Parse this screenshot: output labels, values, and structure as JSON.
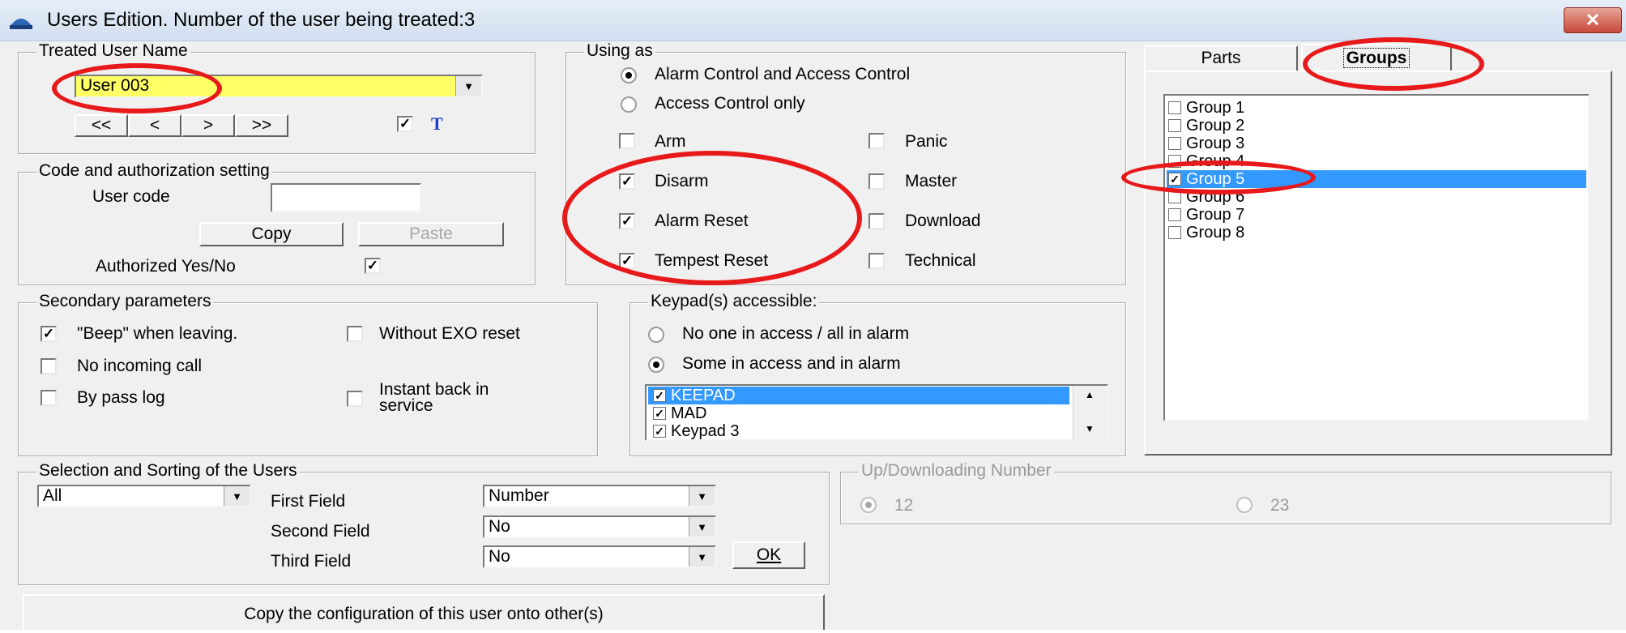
{
  "window": {
    "title": "Users Edition.  Number of the user being treated:3",
    "close_glyph": "✕"
  },
  "treated_user": {
    "group_label": "Treated User Name",
    "selected_user": "User 003",
    "nav": [
      "<<",
      "<",
      ">",
      ">>"
    ],
    "t_checked": true,
    "t_label": "T"
  },
  "code_auth": {
    "group_label": "Code and authorization setting",
    "user_code_label": "User code",
    "user_code_value": "",
    "copy_label": "Copy",
    "paste_label": "Paste",
    "authorized_label": "Authorized Yes/No",
    "authorized_checked": true
  },
  "using_as": {
    "group_label": "Using as",
    "radios": [
      {
        "label": "Alarm Control and Access Control",
        "selected": true
      },
      {
        "label": "Access Control only",
        "selected": false
      }
    ],
    "checkboxes_left": [
      {
        "label": "Arm",
        "checked": false
      },
      {
        "label": "Disarm",
        "checked": true
      },
      {
        "label": "Alarm Reset",
        "checked": true
      },
      {
        "label": "Tempest Reset",
        "checked": true
      }
    ],
    "checkboxes_right": [
      {
        "label": "Panic",
        "checked": false
      },
      {
        "label": "Master",
        "checked": false
      },
      {
        "label": "Download",
        "checked": false
      },
      {
        "label": "Technical",
        "checked": false
      }
    ]
  },
  "tabs": [
    {
      "label": "Parts",
      "active": false
    },
    {
      "label": "Groups",
      "active": true
    }
  ],
  "groups": [
    {
      "label": "Group 1",
      "checked": false,
      "selected": false
    },
    {
      "label": "Group 2",
      "checked": false,
      "selected": false
    },
    {
      "label": "Group 3",
      "checked": false,
      "selected": false
    },
    {
      "label": "Group 4",
      "checked": false,
      "selected": false
    },
    {
      "label": "Group 5",
      "checked": true,
      "selected": true
    },
    {
      "label": "Group 6",
      "checked": false,
      "selected": false
    },
    {
      "label": "Group 7",
      "checked": false,
      "selected": false
    },
    {
      "label": "Group 8",
      "checked": false,
      "selected": false
    }
  ],
  "secondary": {
    "group_label": "Secondary parameters",
    "beep": {
      "label": "\"Beep\" when leaving.",
      "checked": true
    },
    "without_exo": {
      "label": "Without EXO reset",
      "checked": false
    },
    "no_incoming": {
      "label": "No incoming call",
      "checked": false
    },
    "bypass": {
      "label": "By pass log",
      "checked": false
    },
    "instant_back": {
      "line1": "Instant back in",
      "line2": "service",
      "checked": false
    }
  },
  "keypads": {
    "group_label": "Keypad(s) accessible:",
    "radios": [
      {
        "label": "No one in access / all in alarm",
        "selected": false
      },
      {
        "label": "Some in access and in alarm",
        "selected": true
      }
    ],
    "items": [
      {
        "label": "KEEPAD",
        "checked": true,
        "selected": true
      },
      {
        "label": "MAD",
        "checked": true,
        "selected": false
      },
      {
        "label": "Keypad 3",
        "checked": true,
        "selected": false
      }
    ]
  },
  "selection": {
    "group_label": "Selection and Sorting of the Users",
    "filter_value": "All",
    "first_label": "First Field",
    "first_value": "Number",
    "second_label": "Second Field",
    "second_value": "No",
    "third_label": "Third Field",
    "third_value": "No",
    "ok_label": "OK"
  },
  "updownload": {
    "group_label": "Up/Downloading Number",
    "options": [
      {
        "label": "12",
        "selected": true
      },
      {
        "label": "23",
        "selected": false
      }
    ]
  },
  "copy_config_label": "Copy the configuration of this user onto other(s)",
  "colors": {
    "selection_blue": "#3399ff",
    "highlight_yellow": "#ffff66",
    "annotation_red": "#e8191b"
  }
}
